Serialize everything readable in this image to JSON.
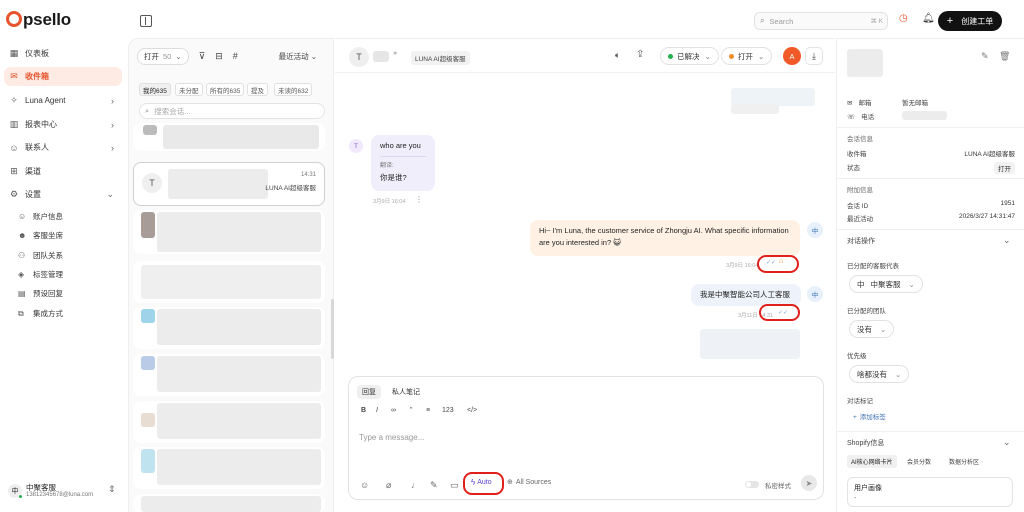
{
  "brand": {
    "name": "psello",
    "accent": "#e8542e"
  },
  "sidebar": {
    "items": [
      {
        "label": "仪表板",
        "icon": "grid-icon"
      },
      {
        "label": "收件箱",
        "icon": "inbox-icon",
        "active": true
      },
      {
        "label": "Luna Agent",
        "icon": "sparkle-icon"
      },
      {
        "label": "报表中心",
        "icon": "chart-icon"
      },
      {
        "label": "联系人",
        "icon": "user-icon"
      },
      {
        "label": "渠道",
        "icon": "plug-icon"
      },
      {
        "label": "设置",
        "icon": "gear-icon"
      }
    ],
    "settings_sub": [
      {
        "label": "账户信息",
        "icon": "user-icon"
      },
      {
        "label": "客服坐席",
        "icon": "agent-icon"
      },
      {
        "label": "团队关系",
        "icon": "team-icon"
      },
      {
        "label": "标签管理",
        "icon": "tag-icon"
      },
      {
        "label": "预设回复",
        "icon": "reply-icon"
      },
      {
        "label": "集成方式",
        "icon": "integration-icon"
      }
    ],
    "user": {
      "avatar": "中",
      "name": "中聚客服",
      "email": "13812345678@luna.com"
    }
  },
  "topbar": {
    "search_placeholder": "Search",
    "search_shortcut": "⌘ K",
    "create_label": "创建工单"
  },
  "conv_list": {
    "status_filter": "打开",
    "status_count": "50",
    "sort_label": "最近活动",
    "chips": [
      "我的635",
      "未分配",
      "所有的635",
      "提及",
      "未读的632"
    ],
    "search_placeholder": "搜索会话...",
    "selected_conv": {
      "avatar": "T",
      "time": "14:31",
      "inbox": "LUNA AI超级客服"
    }
  },
  "chat": {
    "header": {
      "avatar": "T",
      "inbox_badge": "LUNA AI超级客服",
      "resolve_label": "已解决",
      "status_label": "打开",
      "assignee_avatar": "A"
    },
    "messages": [
      {
        "avatar": "T",
        "text": "who are you",
        "translate_label": "翻译:",
        "translation": "你是谁?",
        "time": "3月9日 16:04"
      },
      {
        "avatar": "中",
        "text": "Hi~ I'm Luna, the customer service of Zhongju AI. What specific information are you interested in? 😺",
        "time": "3月9日 16:04"
      },
      {
        "avatar": "中",
        "text": "我是中聚智能公司人工客服",
        "time": "3月11日 14:31"
      }
    ],
    "composer": {
      "tab_reply": "回复",
      "tab_private": "私人笔记",
      "format_buttons": [
        "B",
        "I",
        "∞",
        "\"",
        "≡",
        "123",
        "</>"
      ],
      "placeholder": "Type a message...",
      "auto_label": "Auto",
      "sources_label": "All Sources",
      "style_label": "私密样式"
    }
  },
  "details": {
    "email_label": "邮箱",
    "email_value": "暂无邮箱",
    "phone_label": "电话",
    "conv_info_title": "会话信息",
    "inbox_label": "收件箱",
    "inbox_value": "LUNA AI超级客服",
    "status_label": "状态",
    "status_value": "打开",
    "extra_title": "附加信息",
    "conv_id_label": "会话 ID",
    "conv_id_value": "1951",
    "last_activity_label": "最近活动",
    "last_activity_value": "2026/3/27 14:31:47",
    "actions_title": "对话操作",
    "assigned_agent_label": "已分配的客服代表",
    "assigned_agent_avatar": "中",
    "assigned_agent_value": "中聚客服",
    "assigned_team_label": "已分配的团队",
    "assigned_team_value": "没有",
    "priority_label": "优先级",
    "priority_value": "啥都没有",
    "labels_title": "对话标记",
    "add_label": "添加标签",
    "shopify_title": "Shopify信息",
    "shopify_tabs": [
      "AI核心网络卡片",
      "会员分数",
      "数据分析区"
    ],
    "user_profile_label": "用户画像",
    "user_profile_value": "-"
  }
}
